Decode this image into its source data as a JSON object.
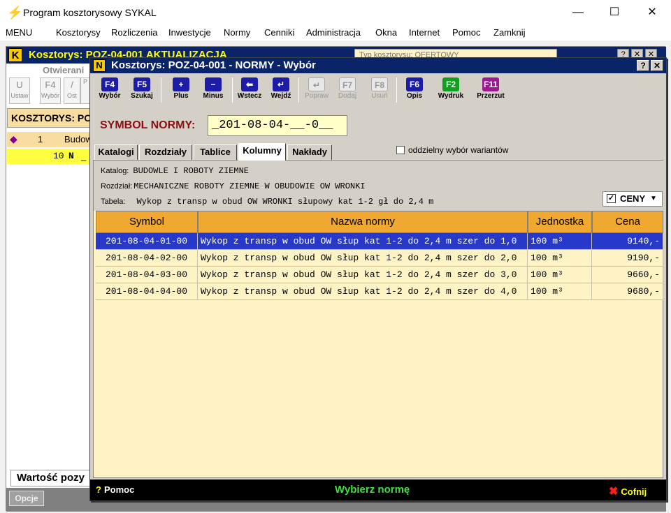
{
  "app": {
    "title": "Program kosztorysowy SYKAL",
    "icon": "sykal-logo-icon",
    "controls": [
      "minimize",
      "maximize",
      "close"
    ]
  },
  "menu": [
    "MENU",
    "Kosztorysy",
    "Rozliczenia",
    "Inwestycje",
    "Normy",
    "Cenniki",
    "Administracja",
    "Okna",
    "Internet",
    "Pomoc",
    "Zamknij"
  ],
  "bg_window": {
    "icon_letter": "K",
    "title": "Kosztorys: POZ-04-001  AKTUALIZACJA",
    "combo": "Typ kosztorysu:  OFERTOWY",
    "title_buttons": [
      "?",
      "✕",
      "✕"
    ],
    "section": "Otwierani",
    "tools": [
      {
        "key": "U",
        "label": "Ustaw"
      },
      {
        "key": "F4",
        "label": "Wybór"
      },
      {
        "key": "/",
        "label": "Ost"
      },
      {
        "key": "",
        "label": "P"
      }
    ],
    "header": "KOSZTORYS:  PO",
    "row1": {
      "num": "1",
      "text": "Budow"
    },
    "row2": {
      "num": "10",
      "flag": "N",
      "text": "_"
    },
    "footer": "Wartość pozy",
    "options": "Opcje"
  },
  "dialog": {
    "icon_letter": "N",
    "title": "Kosztorys: POZ-04-001 - NORMY - Wybór",
    "help_btn": "?",
    "close_btn": "✕",
    "toolbar": [
      {
        "key": "F4",
        "label": "Wybór",
        "color": "#1c1ca8",
        "enabled": true
      },
      {
        "key": "F5",
        "label": "Szukaj",
        "color": "#1c1ca8",
        "enabled": true
      },
      {
        "key": "+",
        "label": "Plus",
        "color": "#1c1ca8",
        "enabled": true
      },
      {
        "key": "−",
        "label": "Minus",
        "color": "#1c1ca8",
        "enabled": true
      },
      {
        "key": "⬅",
        "label": "Wstecz",
        "color": "#1c1ca8",
        "enabled": true
      },
      {
        "key": "↵",
        "label": "Wejdź",
        "color": "#1c1ca8",
        "enabled": true
      },
      {
        "key": "↵",
        "label": "Popraw",
        "color": "#bbbbbb",
        "enabled": false
      },
      {
        "key": "F7",
        "label": "Dodaj",
        "color": "#bbbbbb",
        "enabled": false
      },
      {
        "key": "F8",
        "label": "Usuń",
        "color": "#bbbbbb",
        "enabled": false
      },
      {
        "key": "F6",
        "label": "Opis",
        "color": "#1c1ca8",
        "enabled": true
      },
      {
        "key": "F2",
        "label": "Wydruk",
        "color": "#10a020",
        "enabled": true
      },
      {
        "key": "F11",
        "label": "Przerzut",
        "color": "#9c1890",
        "enabled": true
      }
    ],
    "symbol_label": "SYMBOL NORMY:",
    "symbol_value": "_201-08-04-__-0__",
    "tabs": [
      "Katalogi",
      "Rozdziały",
      "Tablice",
      "Kolumny",
      "Nakłady"
    ],
    "active_tab": "Kolumny",
    "variants_label": "oddzielny wybór wariantów",
    "variants_checked": false,
    "info": {
      "katalog_label": "Katalog:",
      "katalog": "BUDOWLE I ROBOTY ZIEMNE",
      "rozdzial_label": "Rozdział:",
      "rozdzial": "MECHANICZNE ROBOTY ZIEMNE W OBUDOWIE OW WRONKI",
      "tabela_label": "Tabela:",
      "tabela": "Wykop z transp w obud OW WRONKI słupowy kat 1-2 gł do 2,4 m"
    },
    "ceny": {
      "label": "CENY",
      "checked": true,
      "check_mark": "✓",
      "arrow": "▼"
    },
    "columns": [
      "Symbol",
      "Nazwa normy",
      "Jednostka",
      "Cena"
    ],
    "rows": [
      {
        "symbol": "201-08-04-01-00",
        "name": "Wykop z transp w obud OW słup kat 1-2 do 2,4 m szer do 1,0",
        "unit": "100 m³",
        "price": "9140,-",
        "selected": true
      },
      {
        "symbol": "201-08-04-02-00",
        "name": "Wykop z transp w obud OW słup kat 1-2 do 2,4 m szer do 2,0",
        "unit": "100 m³",
        "price": "9190,-",
        "selected": false
      },
      {
        "symbol": "201-08-04-03-00",
        "name": "Wykop z transp w obud OW słup kat 1-2 do 2,4 m szer do 3,0",
        "unit": "100 m³",
        "price": "9660,-",
        "selected": false
      },
      {
        "symbol": "201-08-04-04-00",
        "name": "Wykop z transp w obud OW słup kat 1-2 do 2,4 m szer do 4,0",
        "unit": "100 m³",
        "price": "9680,-",
        "selected": false
      }
    ],
    "status": {
      "help_icon": "?",
      "help": "Pomoc",
      "center": "Wybierz normę",
      "cancel_icon": "✖",
      "cancel": "Cofnij"
    }
  },
  "colors": {
    "dialog_title": "#0a246a",
    "grid_header": "#f0a830",
    "grid_bg": "#fdf3c4",
    "selection": "#2838c8",
    "status_center": "#40e040"
  }
}
